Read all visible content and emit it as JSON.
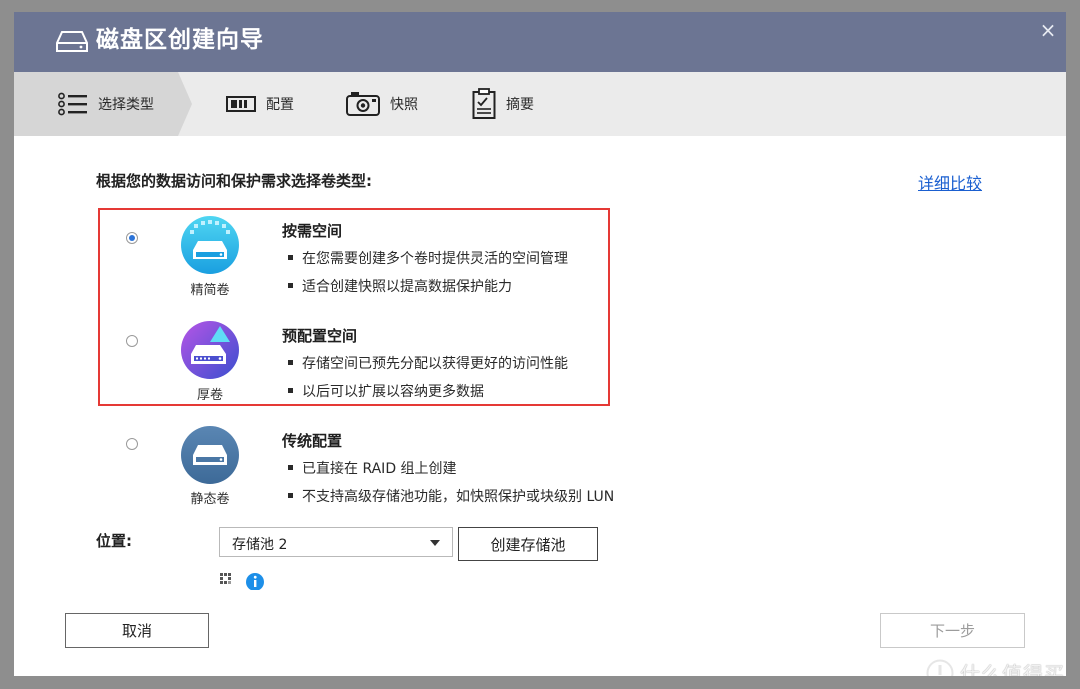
{
  "window": {
    "title": "磁盘区创建向导",
    "close_symbol": "×"
  },
  "steps": [
    {
      "label": "选择类型",
      "icon": "list-icon",
      "active": true
    },
    {
      "label": "配置",
      "icon": "config-icon",
      "active": false
    },
    {
      "label": "快照",
      "icon": "camera-icon",
      "active": false
    },
    {
      "label": "摘要",
      "icon": "clipboard-icon",
      "active": false
    }
  ],
  "instruction": "根据您的数据访问和保护需求选择卷类型:",
  "compare_link": "详细比较",
  "options": [
    {
      "label": "精简卷",
      "title": "按需空间",
      "selected": true,
      "icon": "thin-volume-icon",
      "bullets": [
        "在您需要创建多个卷时提供灵活的空间管理",
        "适合创建快照以提高数据保护能力"
      ]
    },
    {
      "label": "厚卷",
      "title": "预配置空间",
      "selected": false,
      "icon": "thick-volume-icon",
      "bullets": [
        "存储空间已预先分配以获得更好的访问性能",
        "以后可以扩展以容纳更多数据"
      ]
    },
    {
      "label": "静态卷",
      "title": "传统配置",
      "selected": false,
      "icon": "static-volume-icon",
      "bullets": [
        "已直接在 RAID 组上创建",
        "不支持高级存储池功能，如快照保护或块级别 LUN"
      ]
    }
  ],
  "location": {
    "label": "位置:",
    "selected": "存储池 2",
    "create_button": "创建存储池"
  },
  "footer": {
    "cancel": "取消",
    "next": "下一步"
  },
  "watermark": "什么值得买",
  "colors": {
    "titlebar": "#6c7593",
    "accent_blue": "#2b73d8",
    "highlight_border": "#e53935",
    "link": "#1a5fd0"
  }
}
